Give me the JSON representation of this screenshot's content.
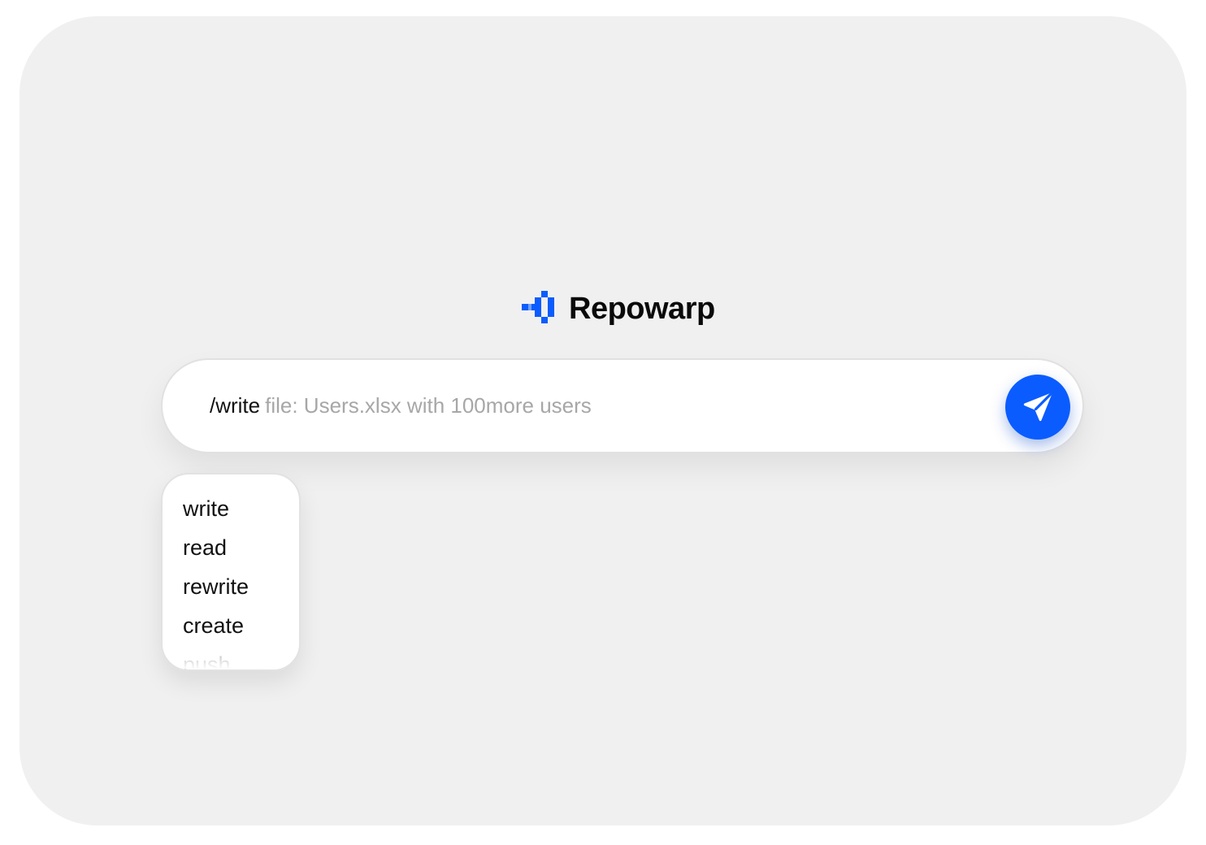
{
  "brand": {
    "name": "Repowarp",
    "logo_icon": "pixel-arrow-logo-icon",
    "accent": "#0a5cff"
  },
  "search": {
    "command": "/write",
    "hint": "file: Users.xlsx with 100more users",
    "send_icon": "paper-plane-icon"
  },
  "suggestions": {
    "items": [
      {
        "label": "write"
      },
      {
        "label": "read"
      },
      {
        "label": "rewrite"
      },
      {
        "label": "create"
      },
      {
        "label": "push"
      }
    ]
  }
}
